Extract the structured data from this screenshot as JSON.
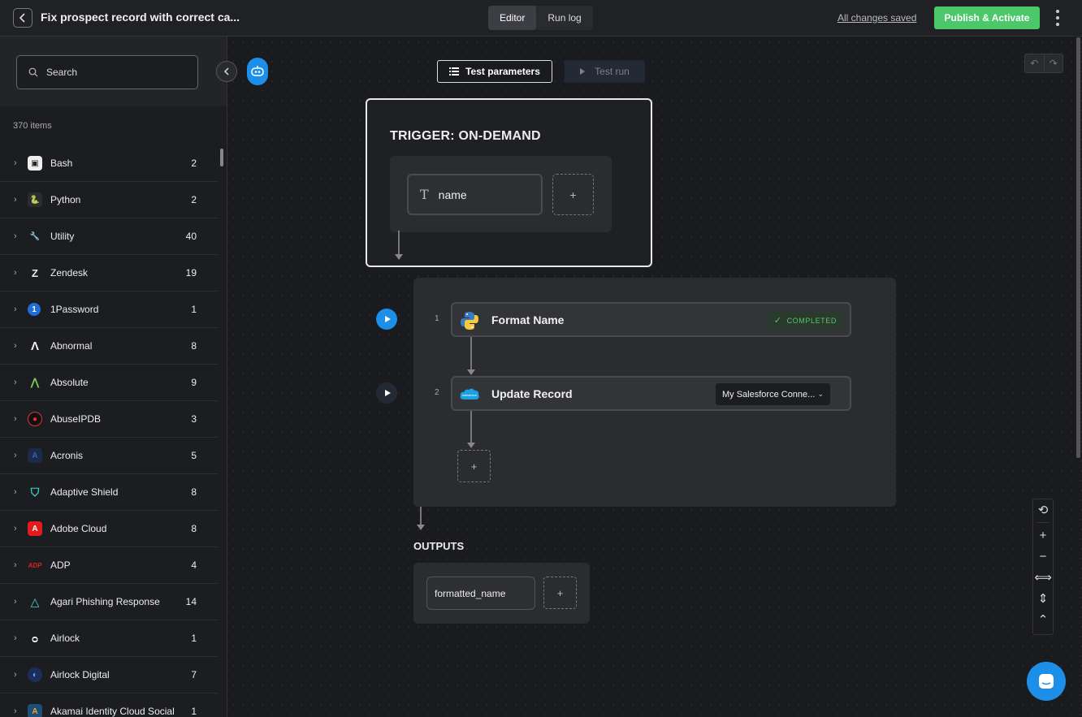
{
  "header": {
    "title": "Fix prospect record with correct ca...",
    "tabs": [
      {
        "label": "Editor"
      },
      {
        "label": "Run log"
      }
    ],
    "saved_status": "All changes saved",
    "publish_label": "Publish & Activate"
  },
  "sidebar": {
    "search_placeholder": "Search",
    "count_label": "370 items",
    "items": [
      {
        "label": "Bash",
        "count": "2"
      },
      {
        "label": "Python",
        "count": "2"
      },
      {
        "label": "Utility",
        "count": "40"
      },
      {
        "label": "Zendesk",
        "count": "19"
      },
      {
        "label": "1Password",
        "count": "1"
      },
      {
        "label": "Abnormal",
        "count": "8"
      },
      {
        "label": "Absolute",
        "count": "9"
      },
      {
        "label": "AbuseIPDB",
        "count": "3"
      },
      {
        "label": "Acronis",
        "count": "5"
      },
      {
        "label": "Adaptive Shield",
        "count": "8"
      },
      {
        "label": "Adobe Cloud",
        "count": "8"
      },
      {
        "label": "ADP",
        "count": "4"
      },
      {
        "label": "Agari Phishing Response",
        "count": "14"
      },
      {
        "label": "Airlock",
        "count": "1"
      },
      {
        "label": "Airlock Digital",
        "count": "7"
      },
      {
        "label": "Akamai Identity Cloud Social",
        "count": "1"
      }
    ]
  },
  "toolbar": {
    "test_params_label": "Test parameters",
    "test_run_label": "Test run"
  },
  "trigger": {
    "title": "TRIGGER: ON-DEMAND",
    "param_name": "name",
    "add_symbol": "+"
  },
  "steps": [
    {
      "number": "1",
      "name": "Format Name",
      "status": "COMPLETED"
    },
    {
      "number": "2",
      "name": "Update Record",
      "connection": "My Salesforce Conne..."
    }
  ],
  "outputs": {
    "title": "OUTPUTS",
    "field": "formatted_name"
  },
  "colors": {
    "accent_blue": "#1e8fe8",
    "publish_green": "#4cc86b",
    "completed_green": "#58c46e"
  }
}
